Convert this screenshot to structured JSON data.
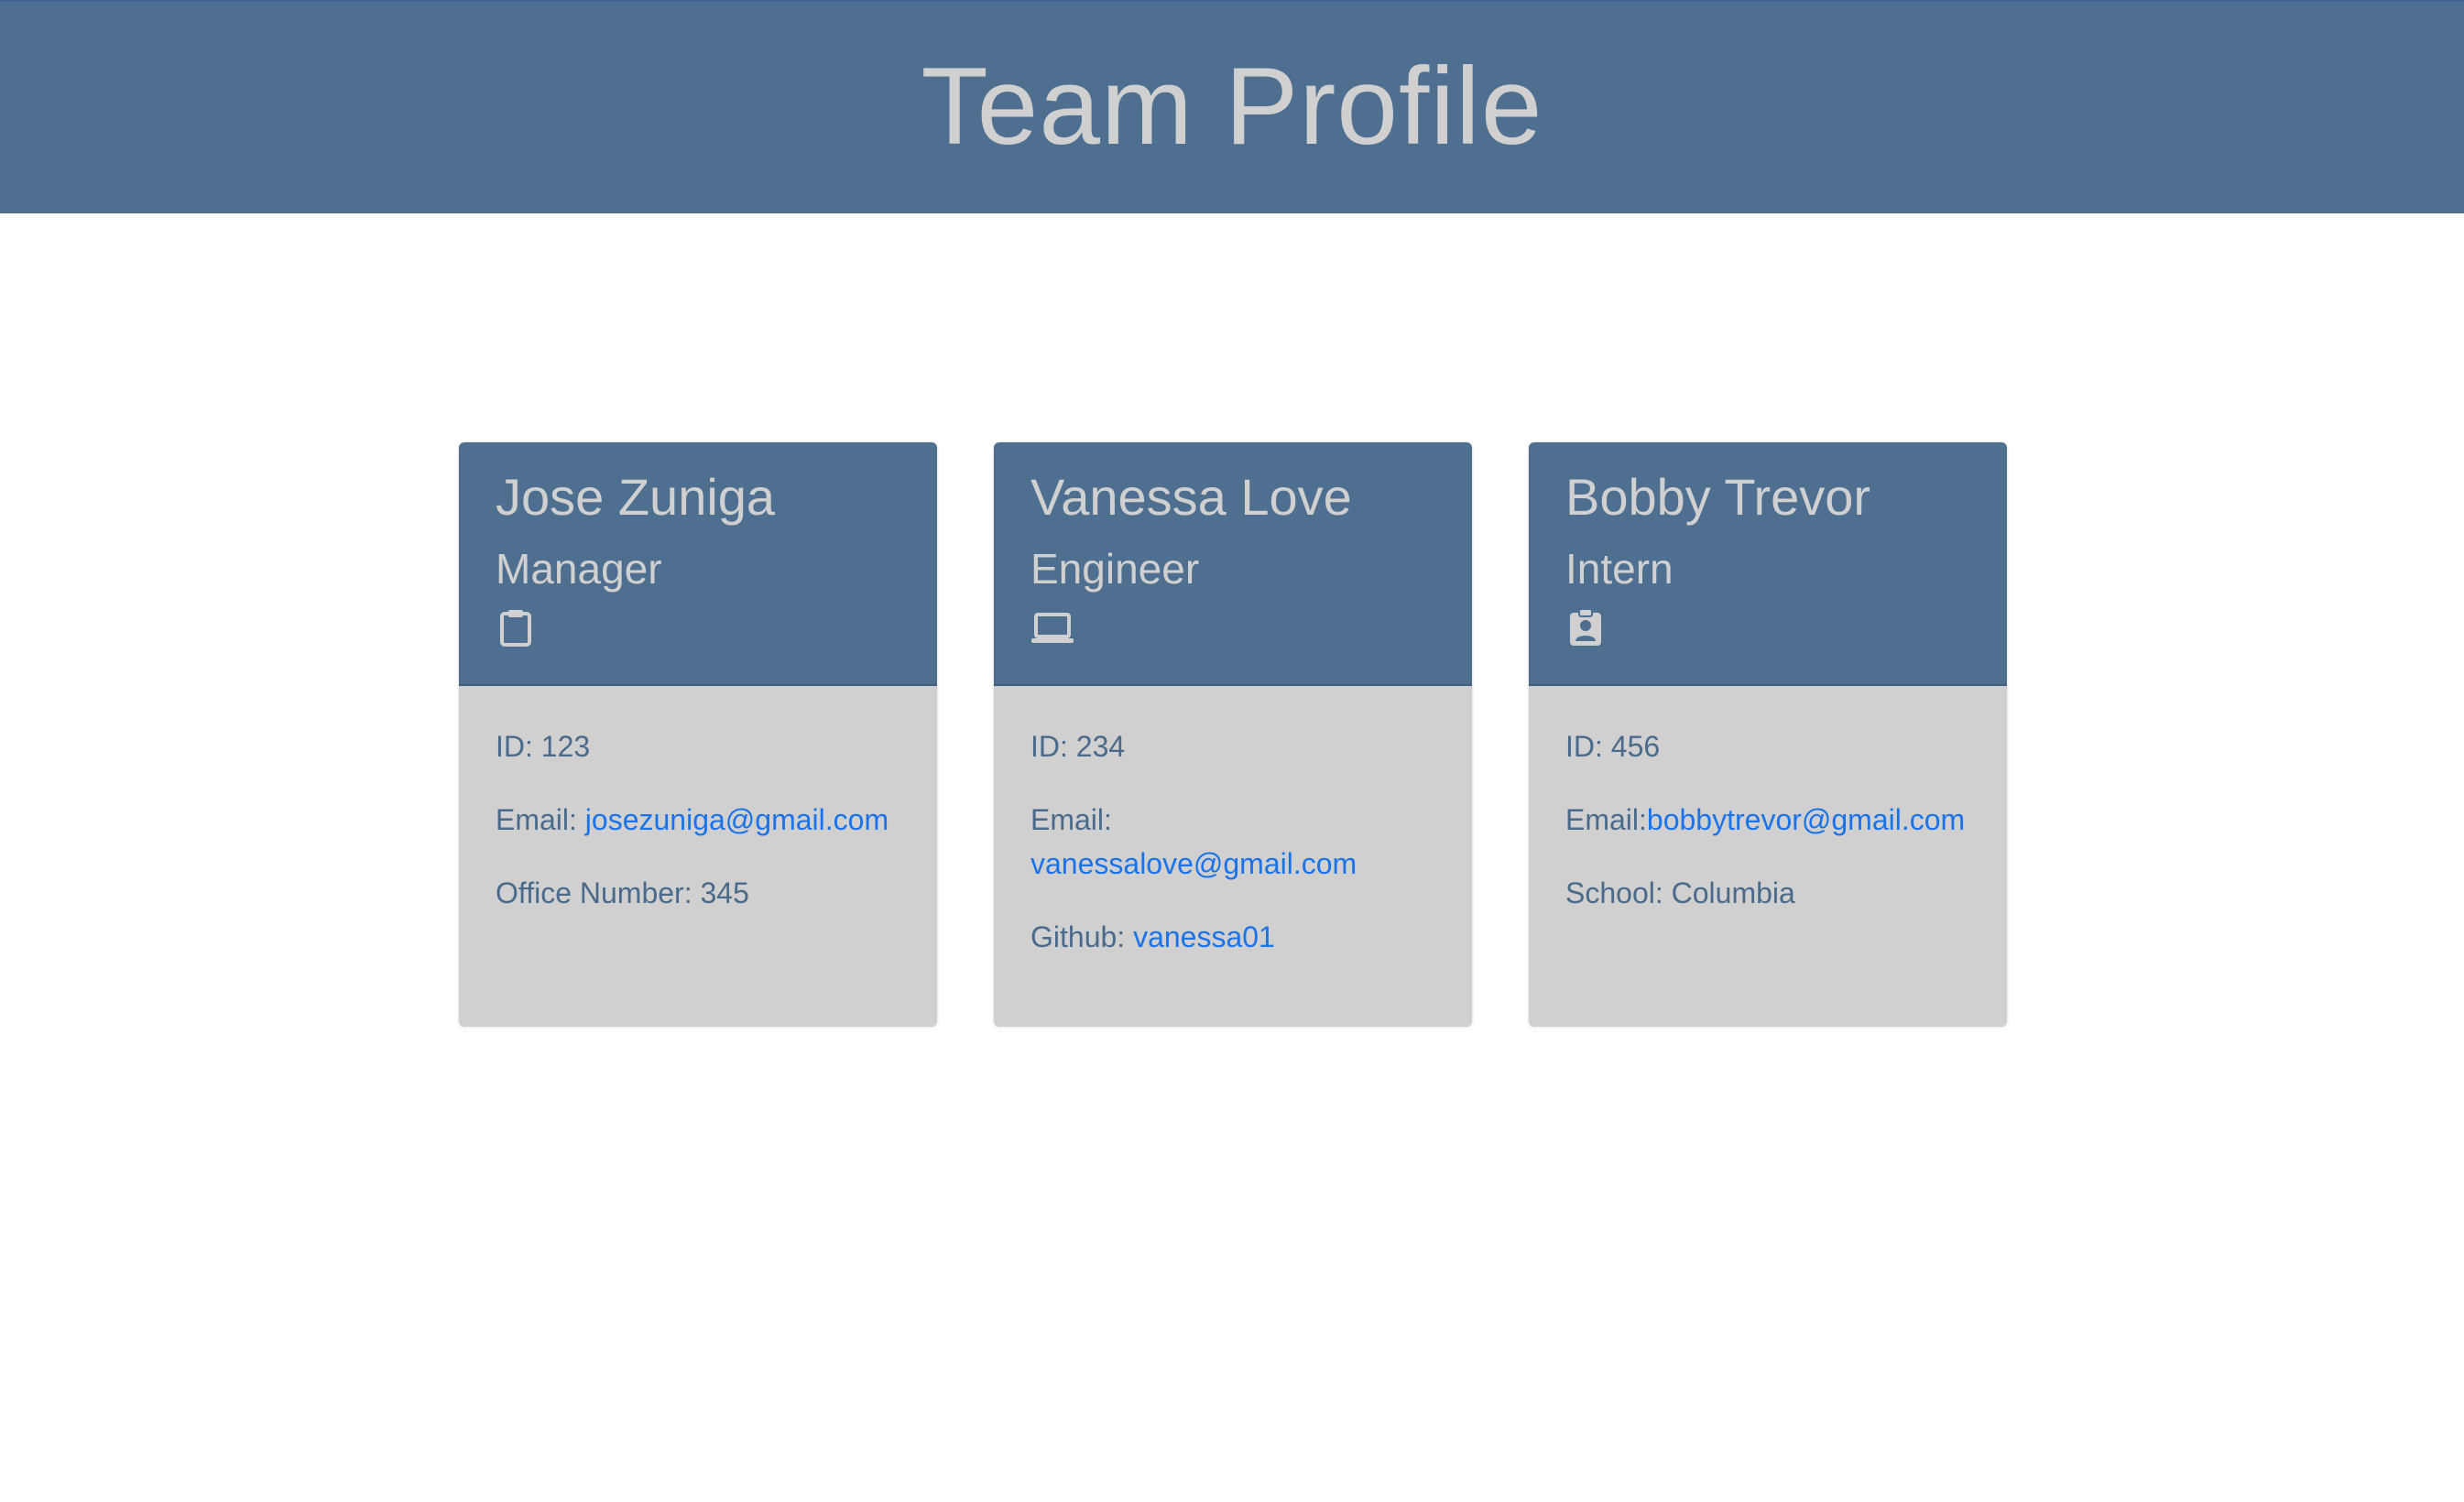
{
  "header": {
    "title": "Team Profile"
  },
  "colors": {
    "header_bg": "#4e6f90",
    "card_bg": "#d0d0d0",
    "title_text": "#d0d0d0",
    "body_text": "#4b6a8a",
    "link": "#1a73e8"
  },
  "cards": [
    {
      "name": "Jose Zuniga",
      "role": "Manager",
      "icon": "clipboard-icon",
      "id_label": "ID: 123",
      "email_label": "Email: ",
      "email": "josezuniga@gmail.com",
      "extra_label": "Office Number: 345"
    },
    {
      "name": "Vanessa Love",
      "role": "Engineer",
      "icon": "laptop-icon",
      "id_label": "ID: 234",
      "email_label": "Email: ",
      "email": "vanessalove@gmail.com",
      "extra_label": "Github: ",
      "extra_link": "vanessa01"
    },
    {
      "name": "Bobby Trevor",
      "role": "Intern",
      "icon": "id-badge-icon",
      "id_label": "ID: 456",
      "email_label": "Email:",
      "email": "bobbytrevor@gmail.com",
      "extra_label": "School: Columbia"
    }
  ]
}
